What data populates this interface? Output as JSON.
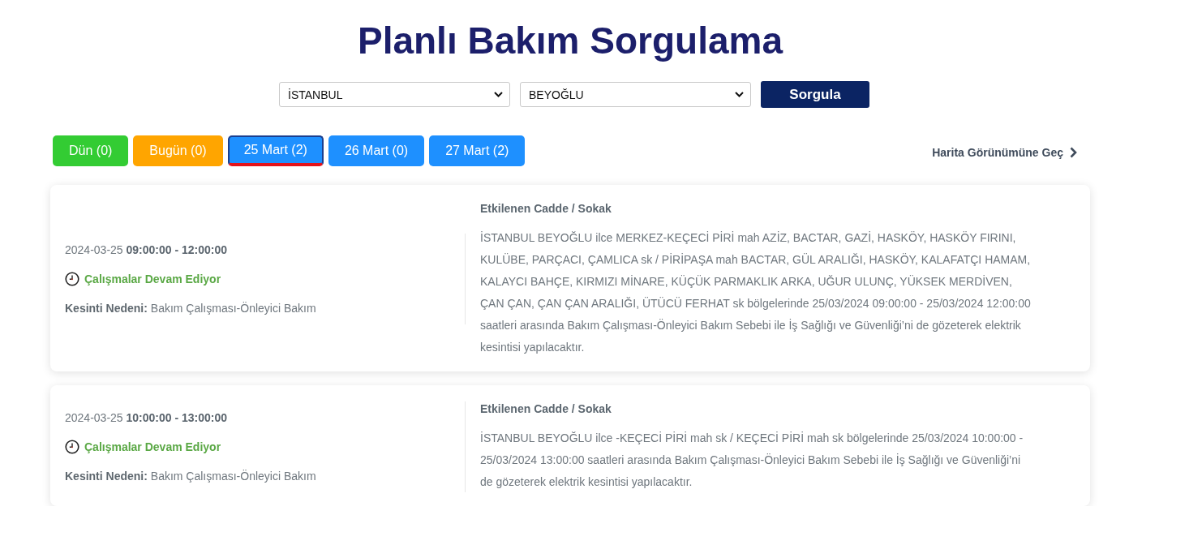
{
  "page": {
    "title": "Planlı Bakım Sorgulama"
  },
  "filters": {
    "dropdowns": [
      {
        "value": "İSTANBUL"
      },
      {
        "value": "BEYOĞLU"
      }
    ],
    "query_button": "Sorgula"
  },
  "day_tabs": [
    {
      "label": "Dün (0)",
      "color": "#33cc33",
      "selected": false
    },
    {
      "label": "Bugün (0)",
      "color": "#ffa500",
      "selected": false
    },
    {
      "label": "25 Mart (2)",
      "color": "#1e90ff",
      "selected": true
    },
    {
      "label": "26 Mart (0)",
      "color": "#1e90ff",
      "selected": false
    },
    {
      "label": "27 Mart (2)",
      "color": "#1e90ff",
      "selected": false
    }
  ],
  "map_view_link": "Harita Görünümüne Geç",
  "outages": [
    {
      "date_time": "2024-03-25 **09:00:00 - 12:00:00**",
      "status": "Çalışmalar Devam Ediyor",
      "reason": "**Kesinti Nedeni:** Bakım Çalışması-Önleyici Bakım",
      "streets_heading": "Etkilenen Cadde / Sokak",
      "description": "İSTANBUL BEYOĞLU ilce MERKEZ-KEÇECİ PİRİ mah AZİZ, BACTAR, GAZİ, HASKÖY, HASKÖY FIRINI, KULÜBE, PARÇACI, ÇAMLICA sk / PİRİPAŞA mah BACTAR, GÜL ARALIĞI, HASKÖY, KALAFATÇI HAMAM, KALAYCI BAHÇE, KIRMIZI MİNARE, KÜÇÜK PARMAKLIK ARKA, UĞUR ULUNÇ, YÜKSEK MERDİVEN, ÇAN ÇAN, ÇAN ÇAN ARALIĞI, ÜTÜCÜ FERHAT sk bölgelerinde 25/03/2024 09:00:00 - 25/03/2024 12:00:00 saatleri arasında Bakım Çalışması-Önleyici Bakım Sebebi ile İş Sağlığı ve Güvenliği’ni de gözeterek elektrik kesintisi yapılacaktır."
    },
    {
      "date_time": "2024-03-25 **10:00:00 - 13:00:00**",
      "status": "Çalışmalar Devam Ediyor",
      "reason": "**Kesinti Nedeni:** Bakım Çalışması-Önleyici Bakım",
      "streets_heading": "Etkilenen Cadde / Sokak",
      "description": "İSTANBUL BEYOĞLU ilce -KEÇECİ PİRİ mah sk / KEÇECİ PİRİ mah sk bölgelerinde 25/03/2024 10:00:00 - 25/03/2024 13:00:00 saatleri arasında Bakım Çalışması-Önleyici Bakım Sebebi ile İş Sağlığı ve Güvenliği’ni de gözeterek elektrik kesintisi yapılacaktır."
    }
  ]
}
